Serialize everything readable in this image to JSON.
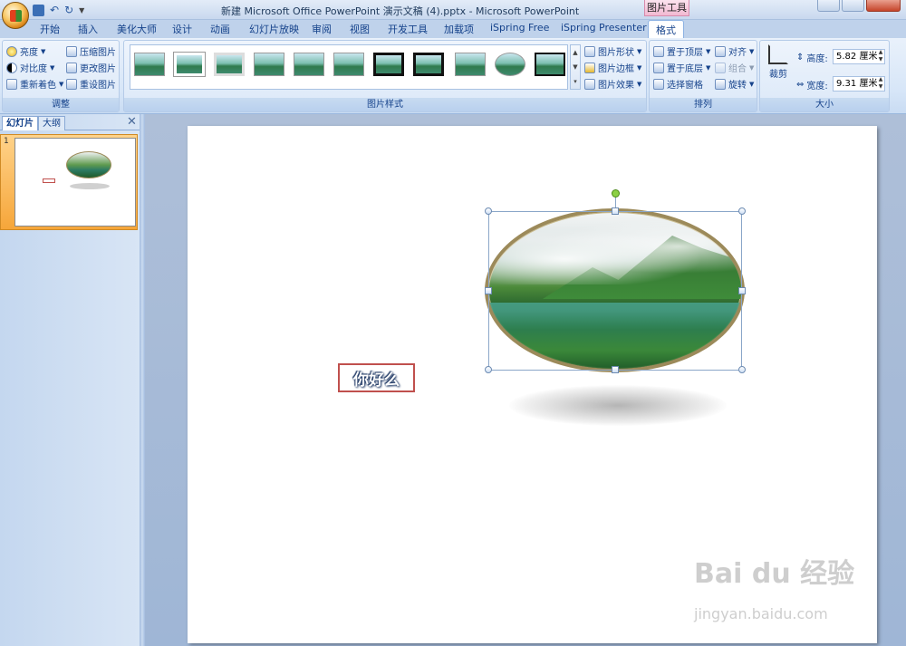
{
  "window": {
    "title": "新建 Microsoft Office PowerPoint 演示文稿 (4).pptx - Microsoft PowerPoint",
    "context_label": "图片工具"
  },
  "tabs": [
    "开始",
    "插入",
    "美化大师",
    "设计",
    "动画",
    "幻灯片放映",
    "审阅",
    "视图",
    "开发工具",
    "加载项",
    "iSpring Free",
    "iSpring Presenter",
    "格式"
  ],
  "active_tab": "格式",
  "ribbon": {
    "adjust": {
      "label": "调整",
      "brightness": "亮度",
      "contrast": "对比度",
      "recolor": "重新着色",
      "compress": "压缩图片",
      "change_picture": "更改图片",
      "reset_picture": "重设图片"
    },
    "styles": {
      "label": "图片样式",
      "shape": "图片形状",
      "border": "图片边框",
      "effects": "图片效果"
    },
    "arrange": {
      "label": "排列",
      "bring_front": "置于顶层",
      "send_back": "置于底层",
      "selection_pane": "选择窗格",
      "align": "对齐",
      "group": "组合",
      "rotate": "旋转"
    },
    "size": {
      "label": "大小",
      "crop": "裁剪",
      "height_label": "高度:",
      "height_value": "5.82 厘米",
      "width_label": "宽度:",
      "width_value": "9.31 厘米"
    }
  },
  "slides_pane": {
    "tab_slides": "幻灯片",
    "tab_outline": "大纲",
    "slide_number": "1"
  },
  "slide": {
    "textbox_text": "你好么"
  },
  "watermark": {
    "main": "Bai du 经验",
    "sub": "jingyan.baidu.com"
  },
  "colors": {
    "accent": "#15428b",
    "textbox_border": "#c0504d",
    "context_tab": "#f2b9d2"
  }
}
